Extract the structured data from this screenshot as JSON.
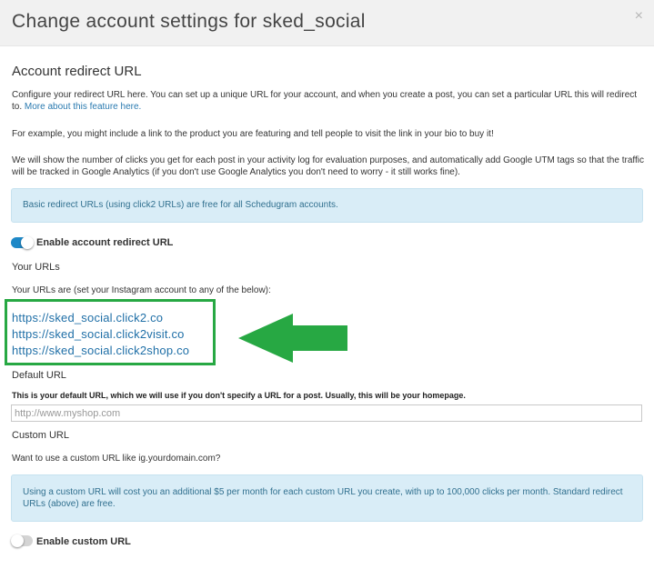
{
  "modal": {
    "title": "Change account settings for sked_social",
    "close_symbol": "×"
  },
  "redirect": {
    "heading": "Account redirect URL",
    "intro": "Configure your redirect URL here. You can set up a unique URL for your account, and when you create a post, you can set a particular URL this will redirect to.",
    "more_link": "More about this feature here.",
    "example": "For example, you might include a link to the product you are featuring and tell people to visit the link in your bio to buy it!",
    "tracking": "We will show the number of clicks you get for each post in your activity log for evaluation purposes, and automatically add Google UTM tags so that the traffic will be tracked in Google Analytics (if you don't use Google Analytics you don't need to worry - it still works fine).",
    "info_basic": "Basic redirect URLs (using click2 URLs) are free for all Schedugram accounts.",
    "enable_label": "Enable account redirect URL",
    "enable_on": true
  },
  "urls": {
    "heading": "Your URLs",
    "intro": "Your URLs are (set your Instagram account to any of the below):",
    "list": [
      "https://sked_social.click2.co",
      "https://sked_social.click2visit.co",
      "https://sked_social.click2shop.co"
    ]
  },
  "default_url": {
    "heading": "Default URL",
    "note": "This is your default URL, which we will use if you don't specify a URL for a post. Usually, this will be your homepage.",
    "placeholder": "http://www.myshop.com",
    "value": ""
  },
  "custom_url": {
    "heading": "Custom URL",
    "question": "Want to use a custom URL like ig.yourdomain.com?",
    "info": "Using a custom URL will cost you an additional $5 per month for each custom URL you create, with up to 100,000 clicks per month. Standard redirect URLs (above) are free.",
    "enable_label": "Enable custom URL",
    "enable_on": false
  },
  "colors": {
    "highlight": "#27a843",
    "toggle_on": "#1e88c7",
    "link": "#1f6fa7",
    "info_bg": "#d9edf7"
  },
  "icons": [
    "close-icon",
    "arrow-left-icon"
  ]
}
